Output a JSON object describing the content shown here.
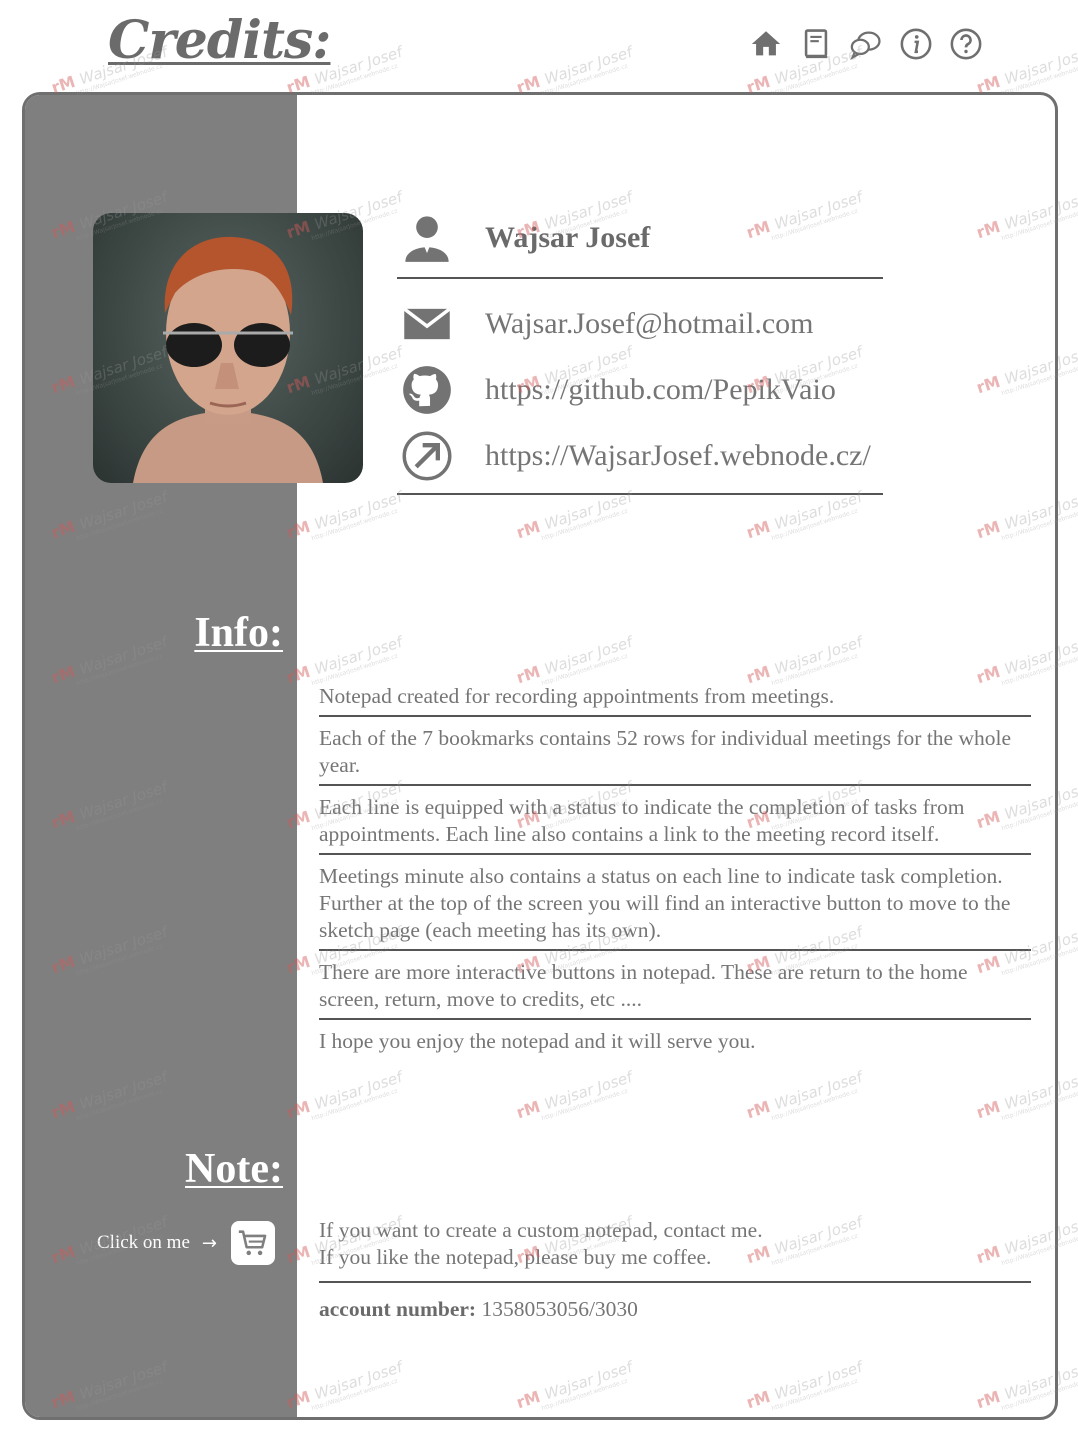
{
  "title": "Credits:",
  "nav": [
    {
      "name": "home-icon",
      "label": "Home"
    },
    {
      "name": "notebook-icon",
      "label": "Notepad"
    },
    {
      "name": "chat-icon",
      "label": "Meetings"
    },
    {
      "name": "info-icon",
      "label": "Info"
    },
    {
      "name": "help-icon",
      "label": "Help"
    }
  ],
  "contact": {
    "name": "Wajsar Josef",
    "email": "Wajsar.Josef@hotmail.com",
    "github": "https://github.com/PepikVaio",
    "website": "https://WajsarJosef.webnode.cz/"
  },
  "info": {
    "label": "Info:",
    "items": [
      "Notepad created for recording appointments from meetings.",
      "Each of the 7 bookmarks contains 52 rows for individual meetings for the whole year.",
      "Each line is equipped with a status to indicate the completion of tasks from appointments. Each line also contains a link to the meeting record itself.",
      "Meetings minute also contains a status on each line to indicate task completion. Further at the top of the screen you will find an interactive button to move to the sketch page (each meeting has its own).",
      "There are more interactive buttons in notepad. These are return to the home screen, return, move to credits, etc ....",
      "I hope you enjoy the notepad and it will serve you."
    ]
  },
  "note": {
    "label": "Note:",
    "click_label": "Click on me",
    "arrow": "→",
    "line1": "If you want to create a custom notepad, contact me.",
    "line2": "If you like the notepad, please buy me coffee.",
    "account_label": "account number:",
    "account_value": "1358053056/3030"
  },
  "watermark": {
    "mark": "rM",
    "name": "Wajsar Josef",
    "url": "http://WajsarJosef.webnode.cz"
  },
  "colors": {
    "sidebar": "#7f7f7f",
    "text": "#777777",
    "border": "#6f6f6f"
  }
}
